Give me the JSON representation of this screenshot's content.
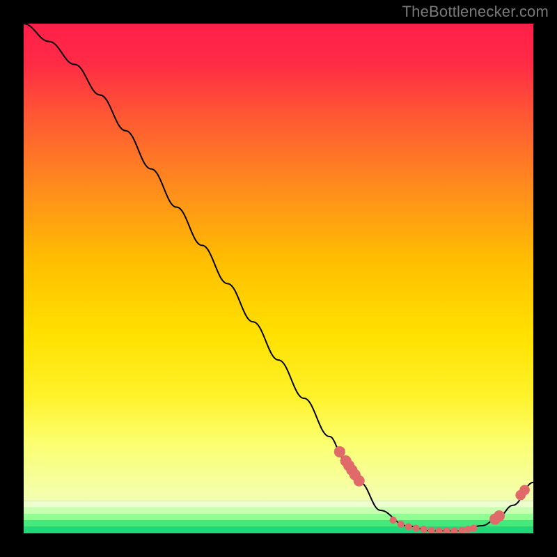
{
  "attribution": "TheBottlenecker.com",
  "chart_data": {
    "type": "line",
    "title": "",
    "xlabel": "",
    "ylabel": "",
    "xlim": [
      0,
      100
    ],
    "ylim": [
      0,
      100
    ],
    "background": {
      "style": "vertical-gradient-with-bottom-bands",
      "main_gradient_stops": [
        {
          "offset": 0,
          "color": "#ff1f49"
        },
        {
          "offset": 50,
          "color": "#ffcc00"
        },
        {
          "offset": 100,
          "color": "#f7ff84"
        }
      ],
      "bottom_bands": [
        {
          "color": "#edffcf"
        },
        {
          "color": "#c8ffb0"
        },
        {
          "color": "#8eff90"
        },
        {
          "color": "#45e87a"
        },
        {
          "color": "#20d878"
        }
      ]
    },
    "series": [
      {
        "name": "bottleneck-curve",
        "color": "#000000",
        "x": [
          0,
          5,
          10,
          15,
          20,
          25,
          30,
          35,
          40,
          45,
          50,
          55,
          60,
          63,
          66,
          70,
          75,
          80,
          85,
          90,
          93,
          96,
          100
        ],
        "y": [
          100,
          96.5,
          92,
          86,
          79,
          71.5,
          64,
          56.5,
          49,
          41.5,
          34,
          26.5,
          19,
          14.5,
          10,
          4.5,
          1.5,
          0.5,
          0.5,
          1.5,
          3,
          5.5,
          10
        ]
      }
    ],
    "markers": [
      {
        "x": 62.0,
        "y": 16.0,
        "r": 1.1,
        "color": "#e06a6a"
      },
      {
        "x": 63.2,
        "y": 14.2,
        "r": 1.1,
        "color": "#e06a6a"
      },
      {
        "x": 63.8,
        "y": 13.3,
        "r": 1.1,
        "color": "#e06a6a"
      },
      {
        "x": 64.4,
        "y": 12.4,
        "r": 1.1,
        "color": "#e06a6a"
      },
      {
        "x": 65.0,
        "y": 11.5,
        "r": 1.1,
        "color": "#e06a6a"
      },
      {
        "x": 65.8,
        "y": 10.3,
        "r": 1.1,
        "color": "#e06a6a"
      },
      {
        "x": 72.5,
        "y": 2.6,
        "r": 0.7,
        "color": "#e06a6a"
      },
      {
        "x": 74.0,
        "y": 1.8,
        "r": 0.7,
        "color": "#e06a6a"
      },
      {
        "x": 75.5,
        "y": 1.3,
        "r": 0.7,
        "color": "#e06a6a"
      },
      {
        "x": 77.0,
        "y": 1.0,
        "r": 0.7,
        "color": "#e06a6a"
      },
      {
        "x": 78.5,
        "y": 0.8,
        "r": 0.7,
        "color": "#e06a6a"
      },
      {
        "x": 80.0,
        "y": 0.6,
        "r": 0.7,
        "color": "#e06a6a"
      },
      {
        "x": 81.5,
        "y": 0.5,
        "r": 0.7,
        "color": "#e06a6a"
      },
      {
        "x": 83.0,
        "y": 0.5,
        "r": 0.7,
        "color": "#e06a6a"
      },
      {
        "x": 84.5,
        "y": 0.5,
        "r": 0.7,
        "color": "#e06a6a"
      },
      {
        "x": 86.0,
        "y": 0.6,
        "r": 0.7,
        "color": "#e06a6a"
      },
      {
        "x": 87.2,
        "y": 0.8,
        "r": 0.7,
        "color": "#e06a6a"
      },
      {
        "x": 88.3,
        "y": 1.0,
        "r": 0.7,
        "color": "#e06a6a"
      },
      {
        "x": 92.5,
        "y": 2.8,
        "r": 1.1,
        "color": "#e06a6a"
      },
      {
        "x": 93.3,
        "y": 3.4,
        "r": 1.1,
        "color": "#e06a6a"
      },
      {
        "x": 97.5,
        "y": 7.5,
        "r": 1.0,
        "color": "#e06a6a"
      },
      {
        "x": 98.3,
        "y": 8.5,
        "r": 1.0,
        "color": "#e06a6a"
      }
    ]
  }
}
